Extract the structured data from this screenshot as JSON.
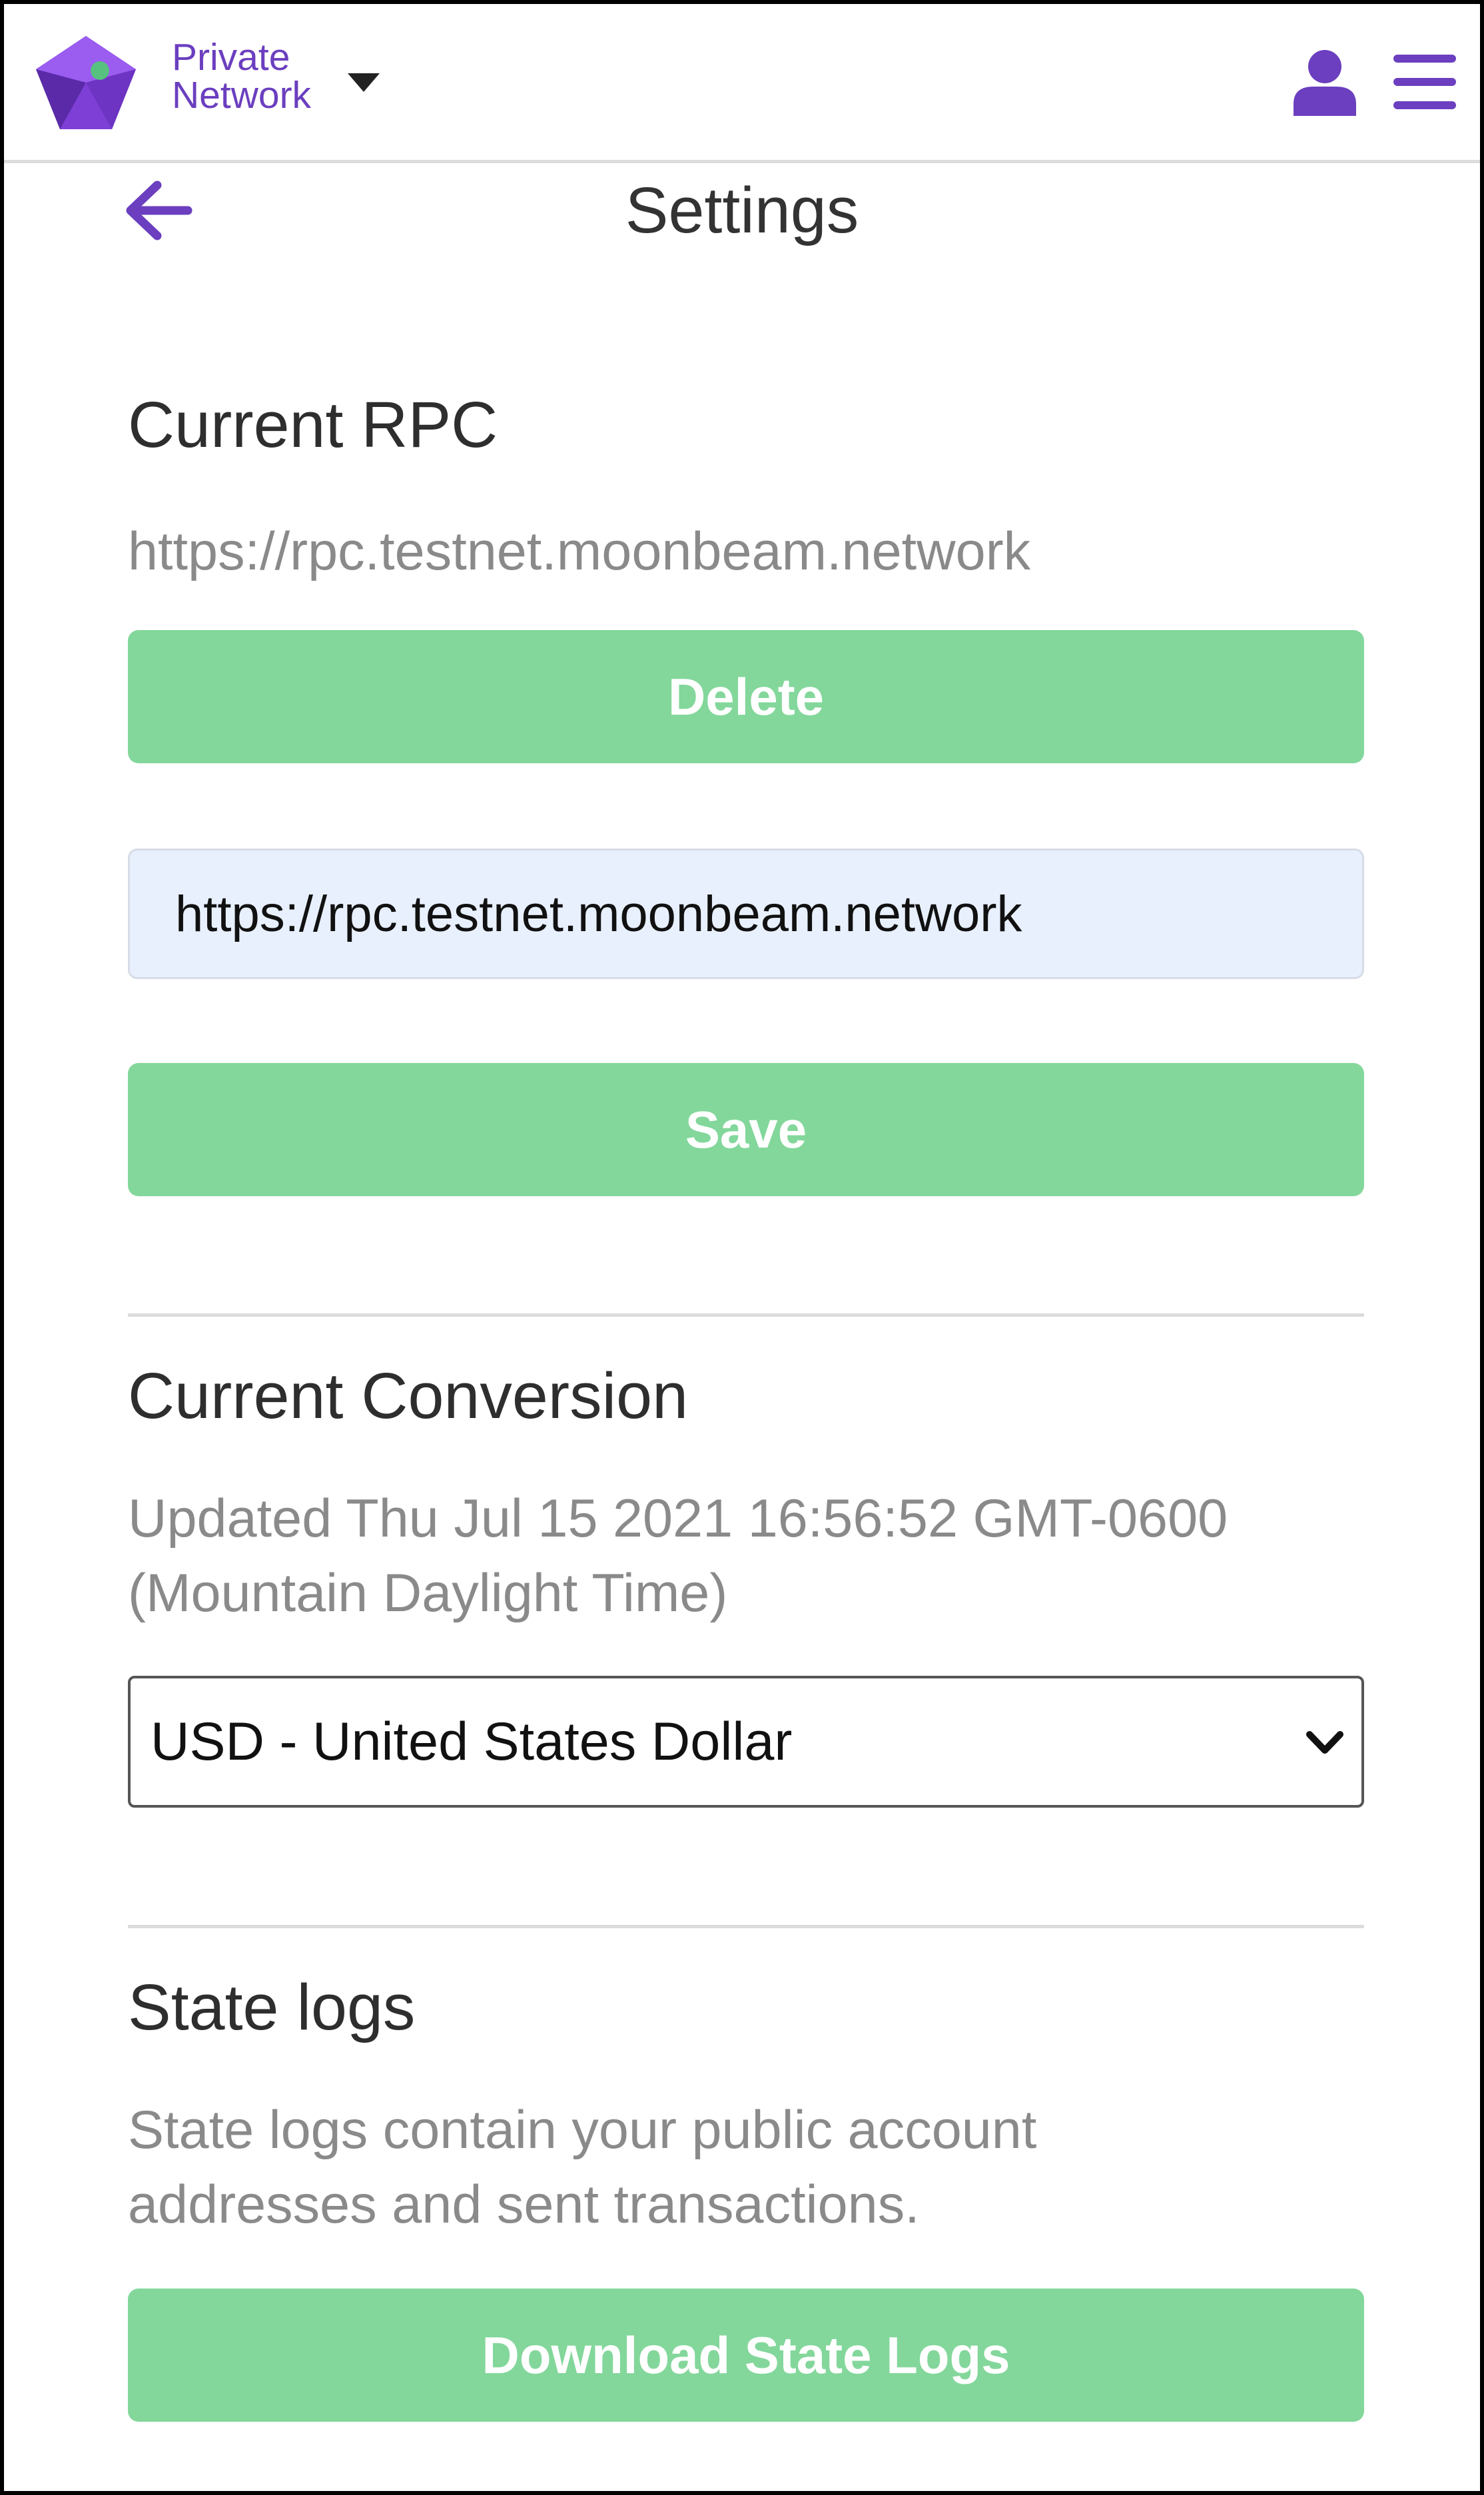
{
  "header": {
    "network_label_line1": "Private",
    "network_label_line2": "Network",
    "logo_icon": "logo-gem-icon",
    "account_icon": "user-icon",
    "menu_icon": "hamburger-menu-icon",
    "brand_color": "#6b3fbf"
  },
  "page": {
    "title": "Settings",
    "back_icon": "arrow-left-icon"
  },
  "rpc": {
    "heading": "Current RPC",
    "current_url": "https://rpc.testnet.moonbeam.network",
    "delete_label": "Delete",
    "input_value": "https://rpc.testnet.moonbeam.network",
    "save_label": "Save"
  },
  "conversion": {
    "heading": "Current Conversion",
    "updated_line1": "Updated Thu Jul 15 2021 16:56:52 GMT-0600",
    "updated_line2": "(Mountain Daylight Time)",
    "selected_currency": "USD - United States Dollar"
  },
  "state_logs": {
    "heading": "State logs",
    "description_line1": "State logs contain your public account",
    "description_line2": "addresses and sent transactions.",
    "download_label": "Download State Logs"
  },
  "colors": {
    "button_green": "#83d79b",
    "input_background": "#e8f0fe",
    "muted_text": "#8a8a8a"
  }
}
